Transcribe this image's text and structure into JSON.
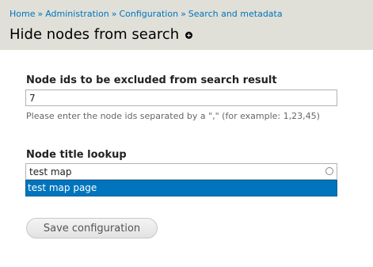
{
  "breadcrumb": {
    "items": [
      "Home",
      "Administration",
      "Configuration",
      "Search and metadata"
    ],
    "separator": "»"
  },
  "page": {
    "title": "Hide nodes from search",
    "shortcut_icon": "plus-circle-icon"
  },
  "form": {
    "node_ids": {
      "label": "Node ids to be excluded from search result",
      "value": "7",
      "description": "Please enter the node ids separated by a \",\" (for example: 1,23,45)"
    },
    "title_lookup": {
      "label": "Node title lookup",
      "value": "test map",
      "throbber_icon": "autocomplete-throbber-icon",
      "suggestions": [
        "test map page"
      ]
    },
    "save_label": "Save configuration"
  },
  "colors": {
    "header_bg": "#e0e0d8",
    "link": "#0074bd",
    "highlight": "#0074bd"
  }
}
